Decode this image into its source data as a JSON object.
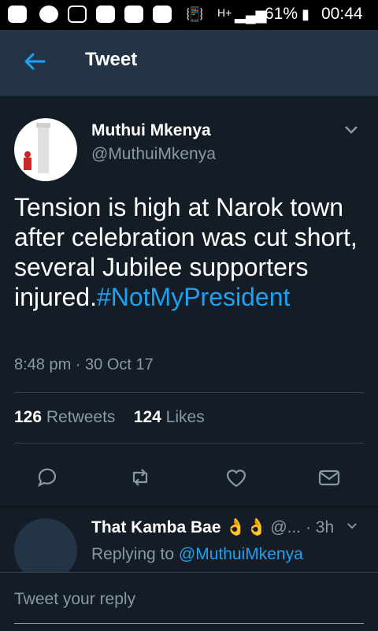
{
  "statusbar": {
    "icons": [
      "bbm-icon",
      "chat-icon",
      "gallery-icon",
      "youtube-icon",
      "youtube-icon",
      "youtube-icon",
      "vibrate-icon",
      "signal-icon",
      "battery-icon"
    ],
    "network": "H+",
    "battery_percent": "61%",
    "time": "00:44"
  },
  "appbar": {
    "title": "Tweet"
  },
  "tweet": {
    "author_name": "Muthui Mkenya",
    "author_handle": "@MuthuiMkenya",
    "text": "Tension is high at Narok town after celebration was cut short, several Jubilee supporters injured.",
    "hashtag": "#NotMyPresident",
    "timestamp": "8:48 pm · 30 Oct 17",
    "retweets_count": "126",
    "retweets_label": "Retweets",
    "likes_count": "124",
    "likes_label": "Likes"
  },
  "reply": {
    "name": "That  Kamba Bae 👌👌",
    "handle_and_time": "@... · 3h",
    "replying_to_label": "Replying to",
    "replying_to_handle": "@MuthuiMkenya"
  },
  "composer": {
    "placeholder": "Tweet your reply"
  },
  "colors": {
    "background": "#141d26",
    "appbar": "#243447",
    "accent": "#1da1f2",
    "muted": "#8899a6"
  }
}
